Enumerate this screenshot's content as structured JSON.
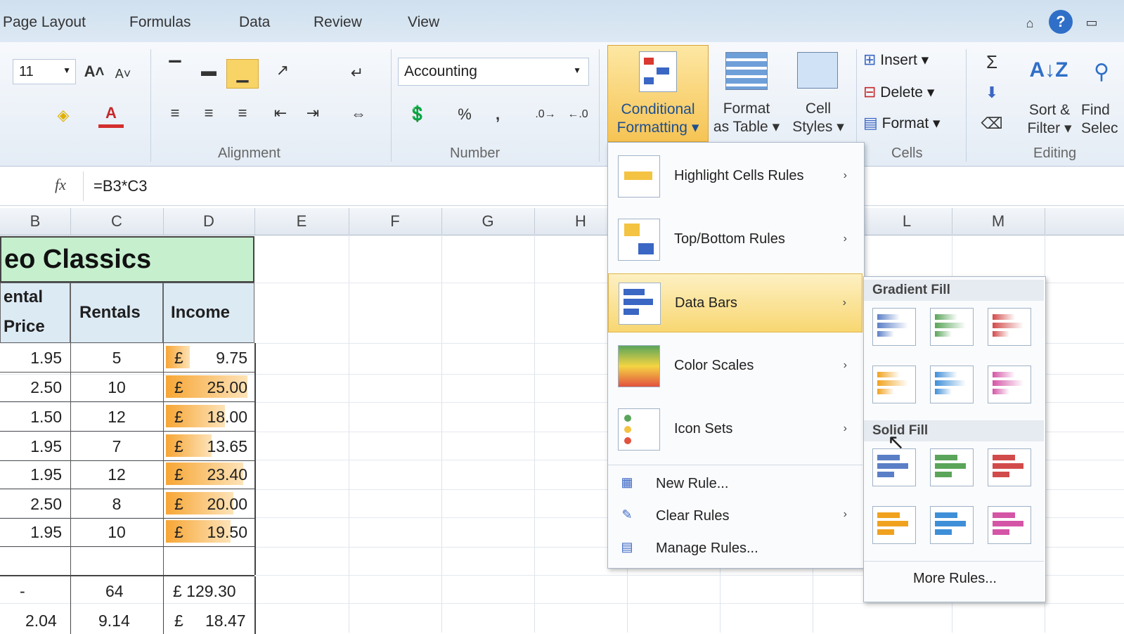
{
  "tabs": [
    "Page Layout",
    "Formulas",
    "Data",
    "Review",
    "View"
  ],
  "ribbon": {
    "font_size": "11",
    "number_format": "Accounting",
    "conditional_formatting": [
      "Conditional",
      "Formatting ▾"
    ],
    "format_as_table": [
      "Format",
      "as Table ▾"
    ],
    "cell_styles": [
      "Cell",
      "Styles ▾"
    ],
    "insert": "Insert",
    "delete": "Delete",
    "format": "Format",
    "sort_filter": [
      "Sort &",
      "Filter ▾"
    ],
    "find_select": [
      "Find",
      "Selec"
    ],
    "groups": {
      "alignment": "Alignment",
      "number": "Number",
      "cells": "Cells",
      "editing": "Editing"
    }
  },
  "formula_bar": {
    "fx": "fx",
    "formula": "=B3*C3"
  },
  "columns": [
    "B",
    "C",
    "D",
    "E",
    "F",
    "G",
    "H",
    "L",
    "M"
  ],
  "sheet": {
    "title": "eo Classics",
    "headers": {
      "b1": "ental",
      "b2": "Price",
      "c": "Rentals",
      "d": "Income"
    },
    "rows": [
      {
        "price": "1.95",
        "rentals": "5",
        "income": "9.75",
        "bar": 0.28
      },
      {
        "price": "2.50",
        "rentals": "10",
        "income": "25.00",
        "bar": 0.97
      },
      {
        "price": "1.50",
        "rentals": "12",
        "income": "18.00",
        "bar": 0.7
      },
      {
        "price": "1.95",
        "rentals": "7",
        "income": "13.65",
        "bar": 0.54
      },
      {
        "price": "1.95",
        "rentals": "12",
        "income": "23.40",
        "bar": 0.92
      },
      {
        "price": "2.50",
        "rentals": "8",
        "income": "20.00",
        "bar": 0.8
      },
      {
        "price": "1.95",
        "rentals": "10",
        "income": "19.50",
        "bar": 0.77
      }
    ],
    "total": {
      "price": "-",
      "rentals": "64",
      "income": "£ 129.30"
    },
    "average": {
      "price": "2.04",
      "rentals": "9.14",
      "income": "18.47"
    },
    "currency": "£"
  },
  "cf_menu": {
    "items": [
      "Highlight Cells Rules",
      "Top/Bottom Rules",
      "Data Bars",
      "Color Scales",
      "Icon Sets"
    ],
    "small_items": [
      "New Rule...",
      "Clear Rules",
      "Manage Rules..."
    ]
  },
  "data_bars_submenu": {
    "gradient_fill": "Gradient Fill",
    "solid_fill": "Solid Fill",
    "more_rules": "More Rules...",
    "colors": [
      "#5b7fc7",
      "#5aa55a",
      "#d24b4b",
      "#f0a21f",
      "#3f8fd8",
      "#d455a6"
    ]
  },
  "colors": {
    "accent": "#f5c342",
    "title_fill": "#c6efce",
    "header_fill": "#dceaf4",
    "bar": "#f7a635"
  }
}
